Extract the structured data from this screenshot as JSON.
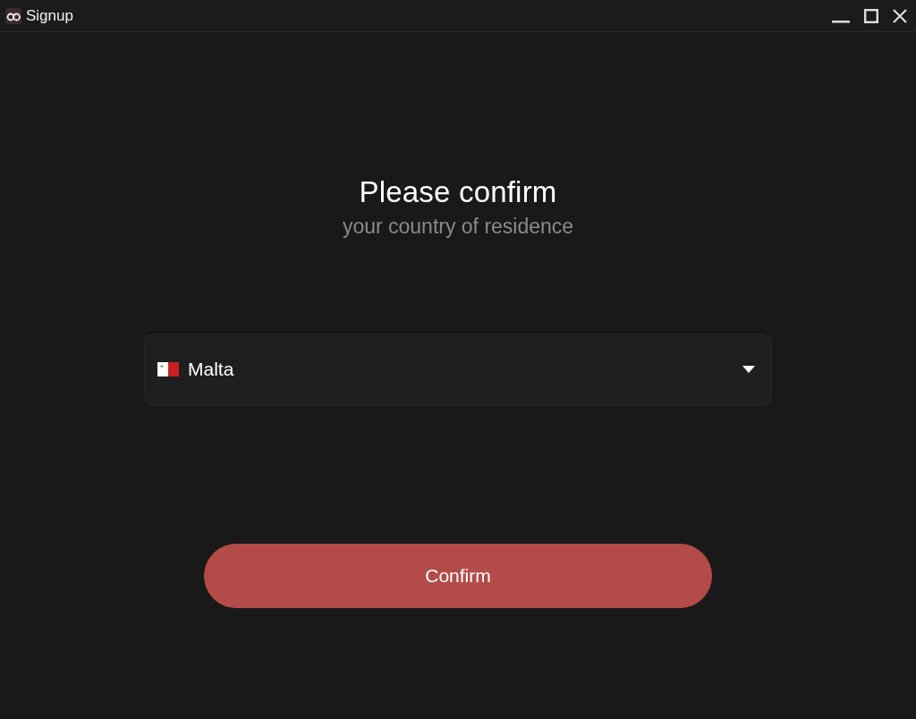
{
  "window": {
    "title": "Signup"
  },
  "heading": "Please confirm",
  "subheading": "your country of residence",
  "country_select": {
    "value": "Malta"
  },
  "confirm_button": {
    "label": "Confirm"
  }
}
